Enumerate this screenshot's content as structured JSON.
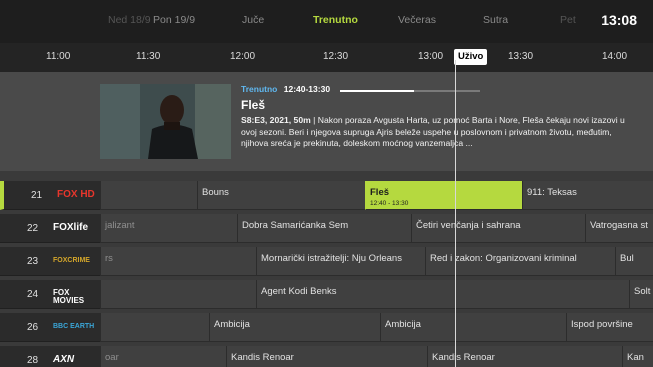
{
  "days": [
    {
      "label": "Ned 18/9",
      "active": false
    },
    {
      "label": "Pon 19/9",
      "active": false
    },
    {
      "label": "Juče",
      "active": false
    },
    {
      "label": "Trenutno",
      "active": true
    },
    {
      "label": "Večeras",
      "active": false
    },
    {
      "label": "Sutra",
      "active": false
    },
    {
      "label": "Pet",
      "active": false
    }
  ],
  "clock": "13:08",
  "ruler": {
    "ticks": [
      "11:00",
      "11:30",
      "12:00",
      "12:30",
      "13:00",
      "13:30",
      "14:00"
    ],
    "live_label": "Uživo"
  },
  "info": {
    "now_label": "Trenutno",
    "time_range": "12:40-13:30",
    "progress": 0.53,
    "title": "Fleš",
    "episode": "S8:E3, 2021, 50m",
    "description": "Nakon poraza Avgusta Harta, uz pomoć Barta i Nore, Fleša čekaju novi izazovi u ovoj sezoni. Beri i njegova supruga Ajris beleže uspehe u poslovnom i privatnom životu, međutim, njihova sreća je prekinuta, doleskom moćnog vanzemaljca ..."
  },
  "channels": [
    {
      "number": "21",
      "logo": "FOX HD",
      "logo_color": "#e8362c",
      "active": true,
      "programs": [
        {
          "title": "",
          "fade": true
        },
        {
          "title": "Bouns",
          "fade": false
        },
        {
          "title": "Fleš",
          "time": "12:40 - 13:30",
          "now": true
        },
        {
          "title": "911: Teksas",
          "fade": false
        }
      ]
    },
    {
      "number": "22",
      "logo": "FOXlife",
      "logo_color": "#ffffff",
      "programs": [
        {
          "title": "jalizant",
          "fade": true
        },
        {
          "title": "Dobra Samarićanka Sem",
          "fade": false
        },
        {
          "title": "Četiri venčanja i sahrana",
          "fade": false
        },
        {
          "title": "Vatrogasna st",
          "fade": false
        }
      ]
    },
    {
      "number": "23",
      "logo": "FOXCRIME",
      "logo_color": "#d4a62a",
      "programs": [
        {
          "title": "rs",
          "fade": true
        },
        {
          "title": "Mornarički istražitelji: Nju Orleans",
          "fade": false
        },
        {
          "title": "Red i zakon: Organizovani kriminal",
          "fade": false
        },
        {
          "title": "Bul",
          "fade": false
        }
      ]
    },
    {
      "number": "24",
      "logo": "FOX MOVIES",
      "logo_color": "#ffffff",
      "programs": [
        {
          "title": "",
          "fade": true
        },
        {
          "title": "Agent Kodi Benks",
          "fade": false
        },
        {
          "title": "Solt",
          "fade": false
        }
      ]
    },
    {
      "number": "26",
      "logo": "BBC EARTH",
      "logo_color": "#3aa6d8",
      "programs": [
        {
          "title": "",
          "fade": true
        },
        {
          "title": "Ambicija",
          "fade": false
        },
        {
          "title": "Ambicija",
          "fade": false
        },
        {
          "title": "Ispod površine",
          "fade": false
        }
      ]
    },
    {
      "number": "28",
      "logo": "AXN",
      "logo_color": "#ffffff",
      "programs": [
        {
          "title": "oar",
          "fade": true
        },
        {
          "title": "Kandis Renoar",
          "fade": false
        },
        {
          "title": "Kandis Renoar",
          "fade": false
        },
        {
          "title": "Kan",
          "fade": false
        }
      ]
    }
  ]
}
